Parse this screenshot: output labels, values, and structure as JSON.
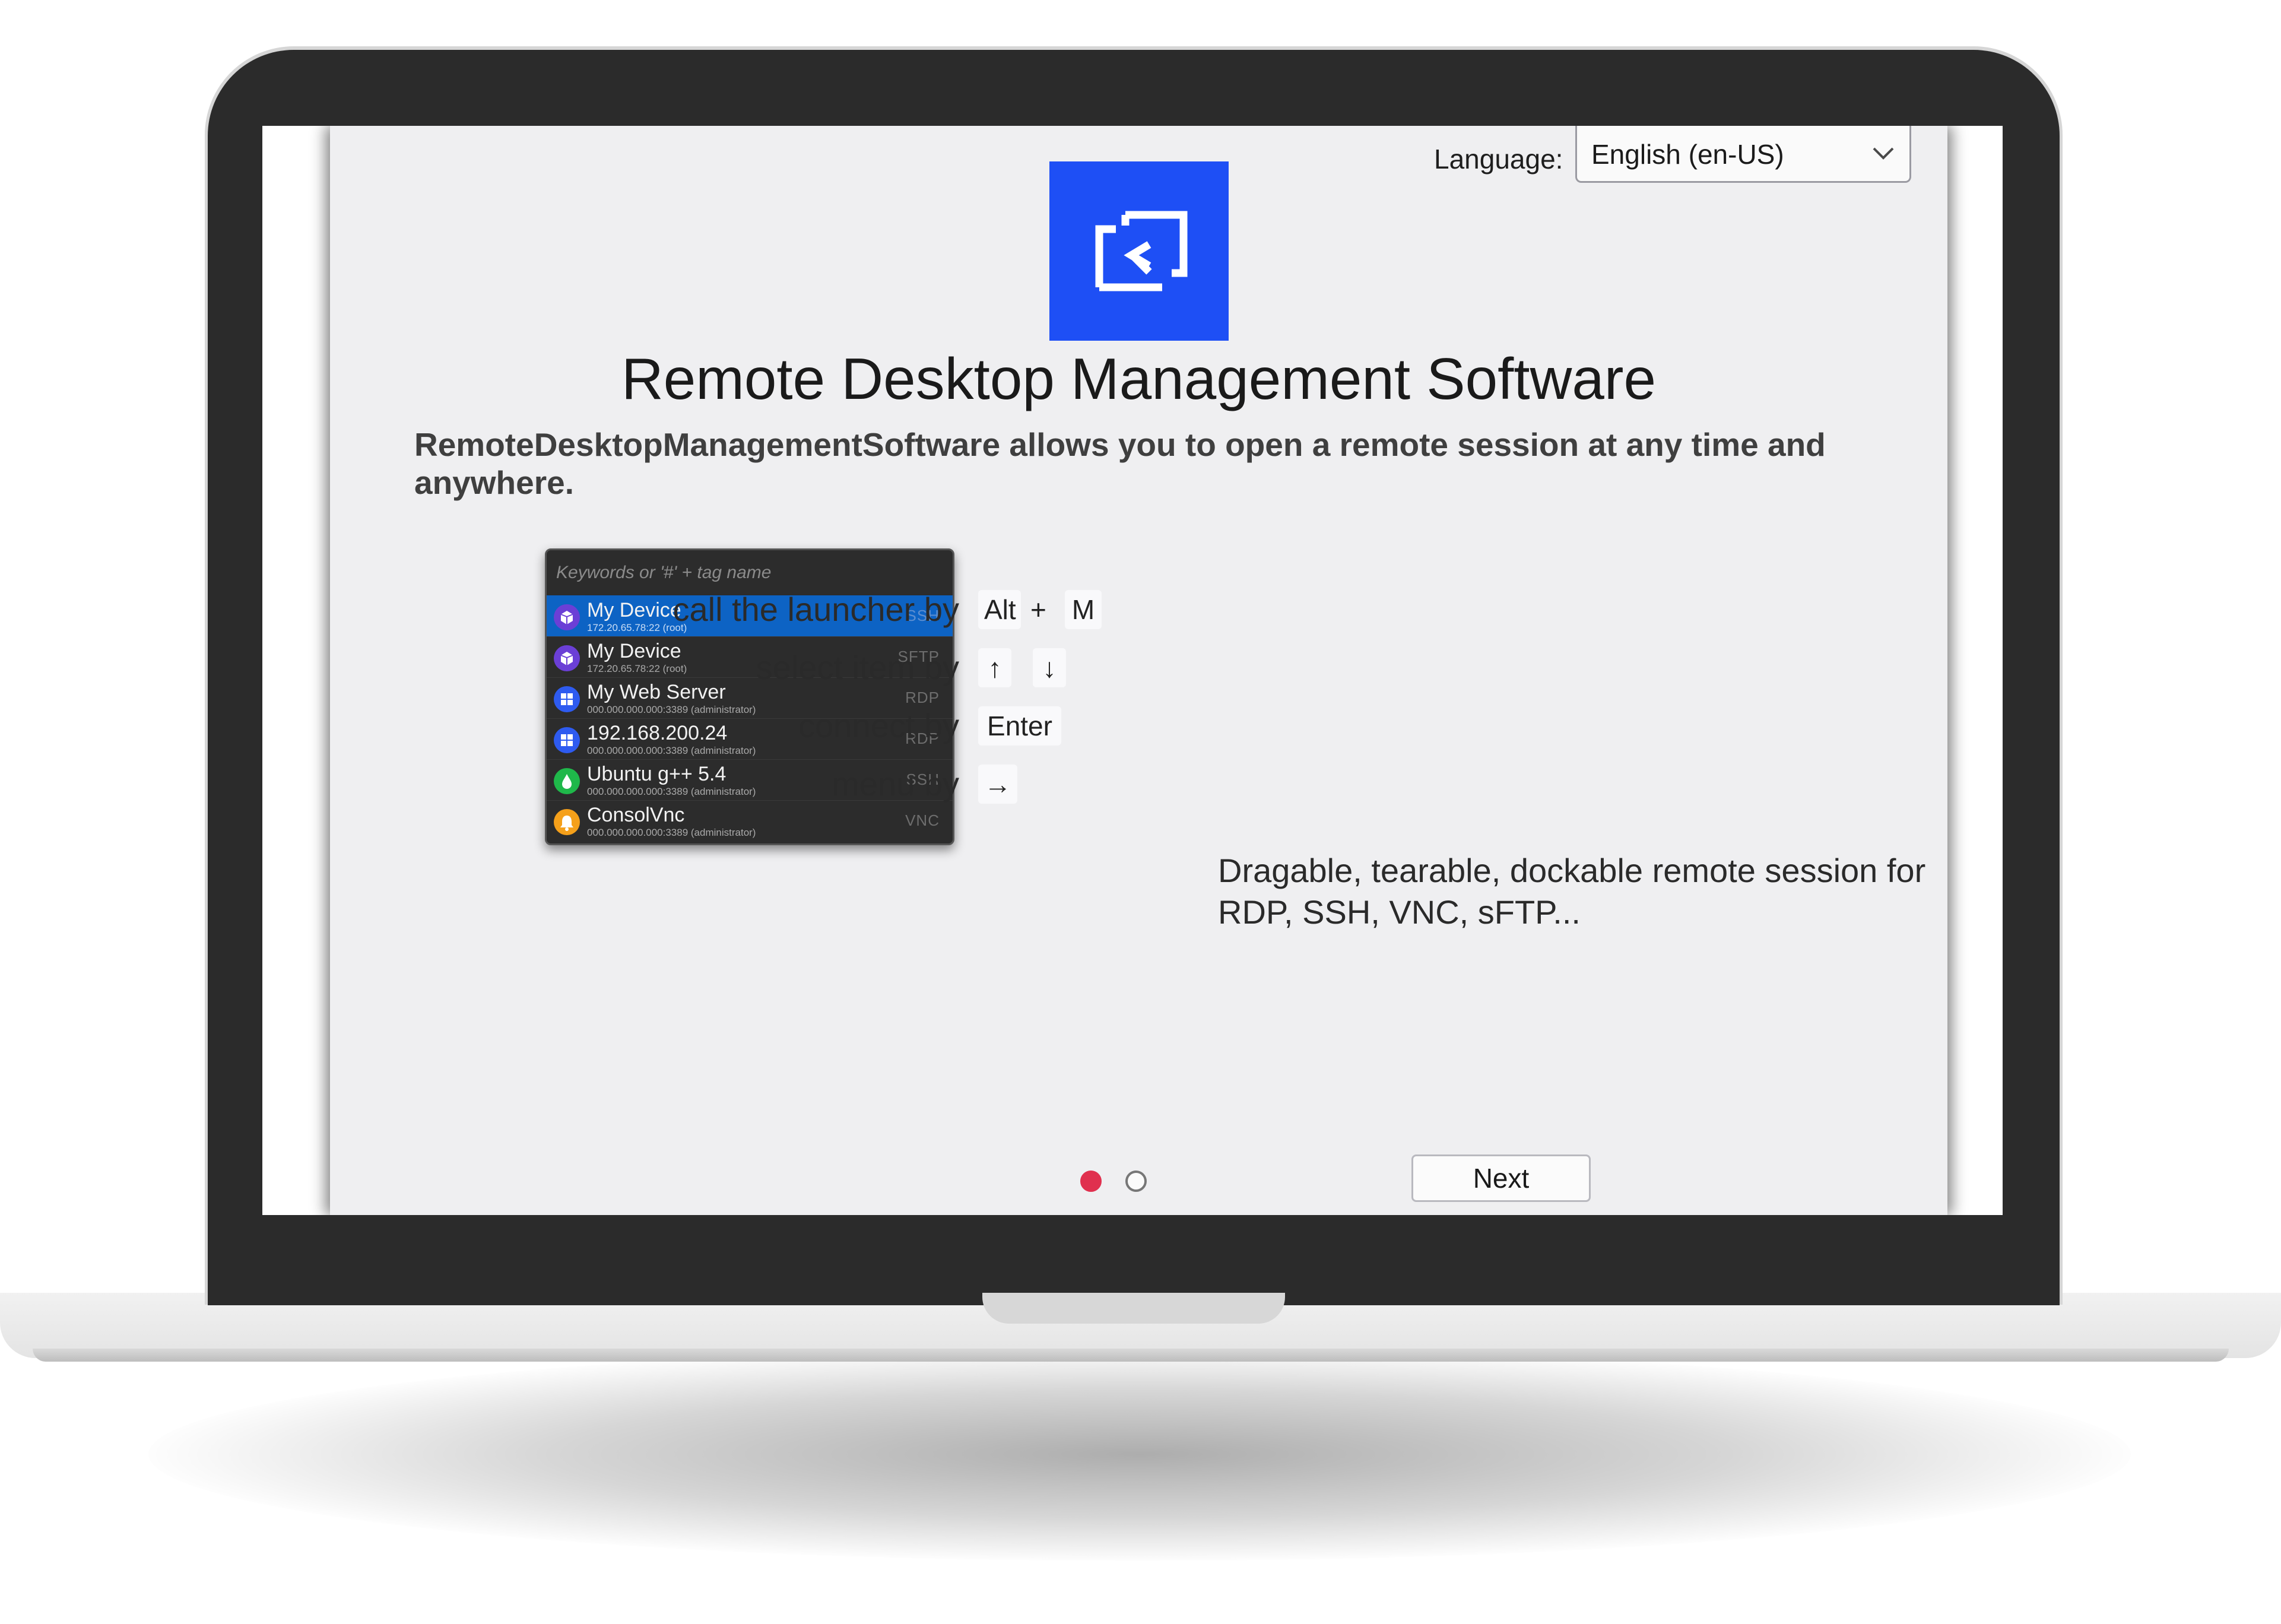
{
  "language": {
    "label": "Language:",
    "selected": "English (en-US)"
  },
  "header": {
    "title": "Remote Desktop Management Software",
    "subtitle": "RemoteDesktopManagementSoftware allows you to open a remote session at any time and anywhere."
  },
  "launcher": {
    "placeholder": "Keywords or '#' + tag name",
    "items": [
      {
        "name": "My Device",
        "address": "172.20.65.78:22 (root)",
        "protocol": "SSH",
        "icon": "ssh-cube-icon",
        "color": "#6b3fd6"
      },
      {
        "name": "My Device",
        "address": "172.20.65.78:22 (root)",
        "protocol": "SFTP",
        "icon": "sftp-cube-icon",
        "color": "#6b3fd6"
      },
      {
        "name": "My Web Server",
        "address": "000.000.000.000:3389 (administrator)",
        "protocol": "RDP",
        "icon": "windows-icon",
        "color": "#2e5bf0"
      },
      {
        "name": "192.168.200.24",
        "address": "000.000.000.000:3389 (administrator)",
        "protocol": "RDP",
        "icon": "windows-icon",
        "color": "#2e5bf0"
      },
      {
        "name": "Ubuntu g++ 5.4",
        "address": "000.000.000.000:3389 (administrator)",
        "protocol": "SSH",
        "icon": "droplet-icon",
        "color": "#1fb84a"
      },
      {
        "name": "ConsolVnc",
        "address": "000.000.000.000:3389 (administrator)",
        "protocol": "VNC",
        "icon": "bell-icon",
        "color": "#f5a01a"
      }
    ]
  },
  "shortcuts": {
    "launcher": {
      "label": "call the launcher by",
      "key1": "Alt",
      "plus": "+",
      "key2": "M"
    },
    "select": {
      "label": "select item by",
      "key1": "↑",
      "key2": "↓"
    },
    "connect": {
      "label": "connect by",
      "key1": "Enter"
    },
    "menu": {
      "label": "menu by",
      "key1": "→"
    }
  },
  "description": "Dragable, tearable, dockable remote session for RDP, SSH, VNC, sFTP...",
  "pagination": {
    "current": 1,
    "total": 2
  },
  "footer": {
    "next_label": "Next"
  },
  "colors": {
    "logo": "#1e4ff5",
    "active_dot": "#e0304e",
    "selected_row": "#0d63c4"
  }
}
